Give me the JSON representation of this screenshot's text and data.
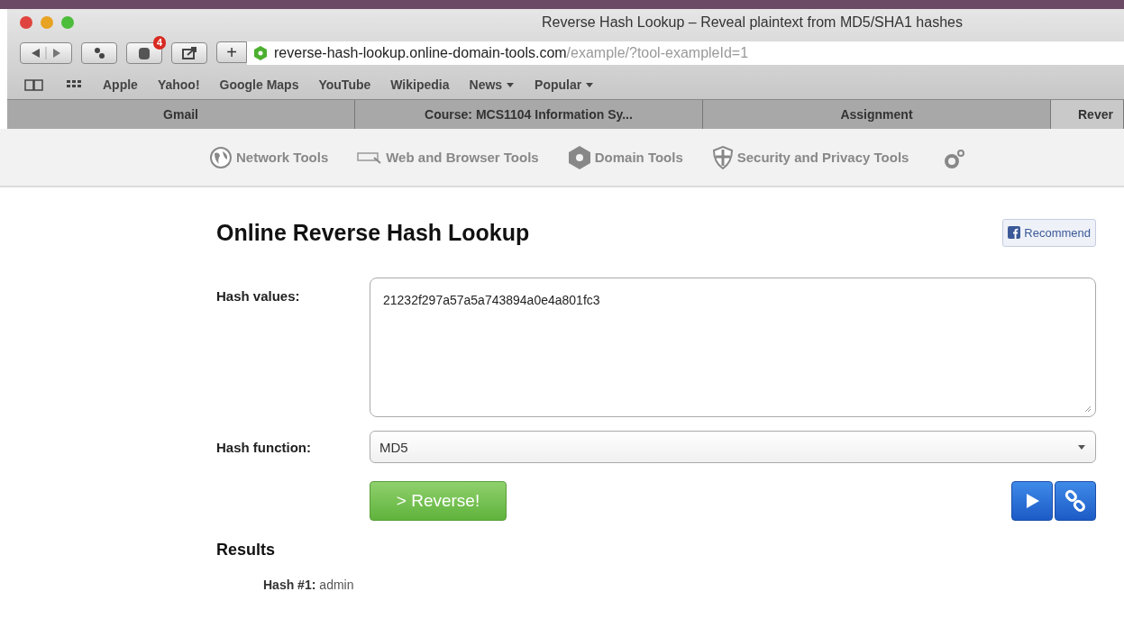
{
  "window": {
    "title": "Reverse Hash Lookup – Reveal plaintext from MD5/SHA1 hashes"
  },
  "toolbar": {
    "notification_count": "4",
    "url_host": "reverse-hash-lookup.online-domain-tools.com",
    "url_path": "/example/?tool-exampleId=1",
    "new_tab": "+"
  },
  "bookmarks": [
    {
      "label": "Apple",
      "menu": false
    },
    {
      "label": "Yahoo!",
      "menu": false
    },
    {
      "label": "Google Maps",
      "menu": false
    },
    {
      "label": "YouTube",
      "menu": false
    },
    {
      "label": "Wikipedia",
      "menu": false
    },
    {
      "label": "News",
      "menu": true
    },
    {
      "label": "Popular",
      "menu": true
    }
  ],
  "tabs": [
    {
      "label": "Gmail",
      "selected": false
    },
    {
      "label": "Course: MCS1104 Information Sy...",
      "selected": false
    },
    {
      "label": "Assignment",
      "selected": false
    },
    {
      "label": "Rever",
      "selected": true
    }
  ],
  "site_nav": [
    {
      "label": "Network Tools",
      "kind": "globe"
    },
    {
      "label": "Web and Browser Tools",
      "kind": "browser"
    },
    {
      "label": "Domain Tools",
      "kind": "hexagon"
    },
    {
      "label": "Security and Privacy Tools",
      "kind": "shield"
    }
  ],
  "page": {
    "heading": "Online Reverse Hash Lookup",
    "recommend": "Recommend",
    "hash_values_label": "Hash values:",
    "hash_values": "21232f297a57a5a743894a0e4a801fc3",
    "hash_function_label": "Hash function:",
    "hash_function": "MD5",
    "submit": "> Reverse!",
    "results_heading": "Results",
    "results": [
      {
        "label": "Hash #1:",
        "value": "admin"
      }
    ]
  }
}
